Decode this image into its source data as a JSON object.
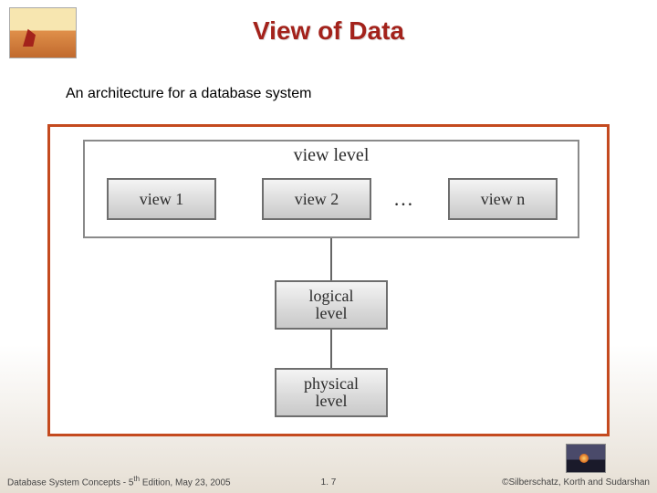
{
  "title": "View of Data",
  "subtitle": "An architecture for a database system",
  "diagram": {
    "view_level_label": "view level",
    "views": {
      "v1": "view 1",
      "v2": "view 2",
      "vn": "view n",
      "ellipsis": "…"
    },
    "logical": "logical\nlevel",
    "physical": "physical\nlevel"
  },
  "footer": {
    "left_prefix": "Database System Concepts - 5",
    "left_sup": "th",
    "left_suffix": " Edition, May 23, 2005",
    "center": "1. 7",
    "right": "©Silberschatz, Korth and Sudarshan"
  }
}
